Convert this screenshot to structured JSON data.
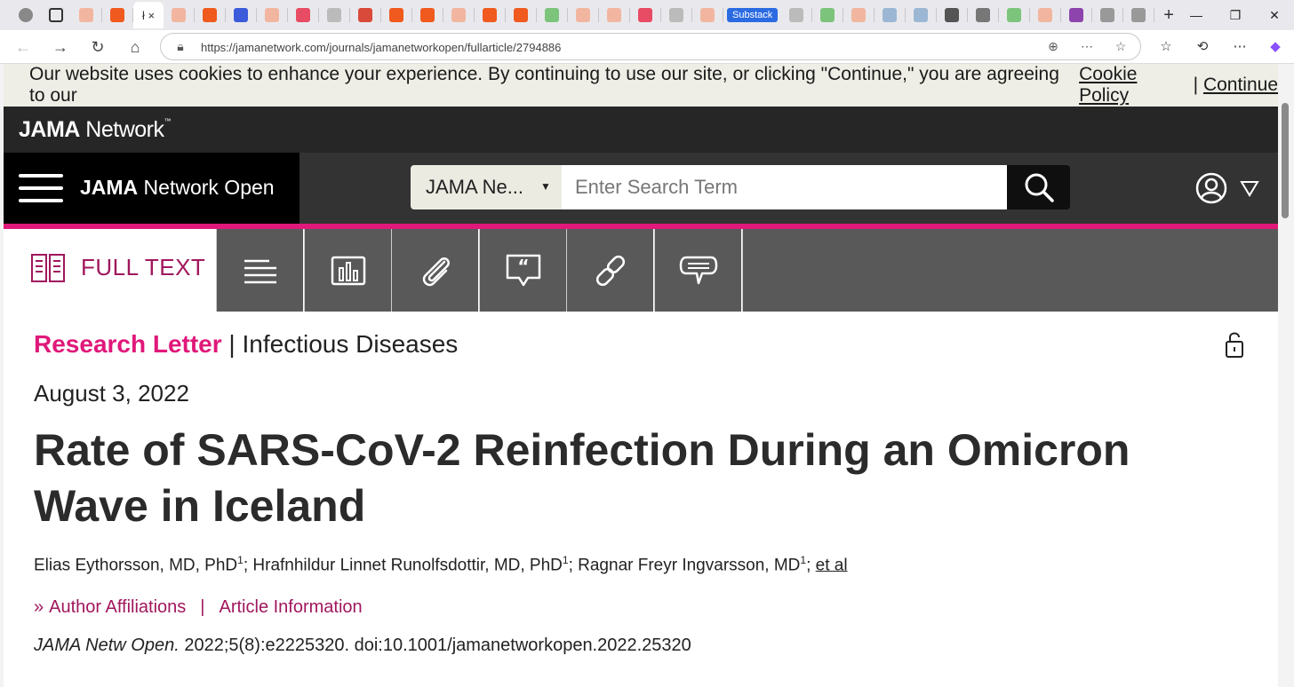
{
  "browser": {
    "substack_tab_label": "Substack",
    "active_tab_label": "ł ×",
    "url": "https://jamanetwork.com/journals/jamanetworkopen/fullarticle/2794886",
    "tab_favicon_colors": [
      "#f2b6a0",
      "#f05a1e",
      "#f2b6a0",
      "#f05a1e",
      "#3b5bdb",
      "#f2b6a0",
      "#e84b64",
      "#bbbbbb",
      "#d94a3a",
      "#f05a1e",
      "#f05a1e",
      "#f2b6a0",
      "#f05a1e",
      "#f05a1e",
      "#7cc47c",
      "#f2b6a0",
      "#f2b6a0",
      "#e84b64",
      "#bbbbbb",
      "#f2b6a0"
    ],
    "tab_favicon_colors_right": [
      "#bbbbbb",
      "#7cc47c",
      "#f2b6a0",
      "#9bb7d4",
      "#9bb7d4",
      "#555555",
      "#777777",
      "#7cc47c",
      "#f2b6a0",
      "#8e44ad",
      "#999999",
      "#999999"
    ]
  },
  "cookie_banner": {
    "text": "Our website uses cookies to enhance your experience. By continuing to use our site, or clicking \"Continue,\" you are agreeing to our",
    "policy_link": "Cookie Policy",
    "separator": "|",
    "continue_link": "Continue"
  },
  "header": {
    "network_logo_bold": "JAMA",
    "network_logo_rest": " Network",
    "network_logo_tm": "™",
    "journal_bold": "JAMA",
    "journal_rest": " Network Open",
    "search_scope": "JAMA Ne...",
    "search_placeholder": "Enter Search Term"
  },
  "tools": {
    "full_text_label": "FULL TEXT"
  },
  "article": {
    "type_label": "Research Letter",
    "type_separator": " | ",
    "category": "Infectious Diseases",
    "date": "August 3, 2022",
    "title": "Rate of SARS-CoV-2 Reinfection During an Omicron Wave in Iceland",
    "authors": [
      {
        "name": "Elias Eythorsson, MD, PhD",
        "sup": "1"
      },
      {
        "name": "Hrafnhildur Linnet Runolfsdottir, MD, PhD",
        "sup": "1"
      },
      {
        "name": "Ragnar Freyr Ingvarsson, MD",
        "sup": "1"
      }
    ],
    "et_al": "et al",
    "author_affiliations": "Author Affiliations",
    "article_information": "Article Information",
    "citation_journal": "JAMA Netw Open.",
    "citation_rest": " 2022;5(8):e2225320. doi:10.1001/jamanetworkopen.2022.25320"
  },
  "colors": {
    "accent_pink": "#e0187a",
    "link_maroon": "#a0175d",
    "tool_gray": "#595959"
  }
}
